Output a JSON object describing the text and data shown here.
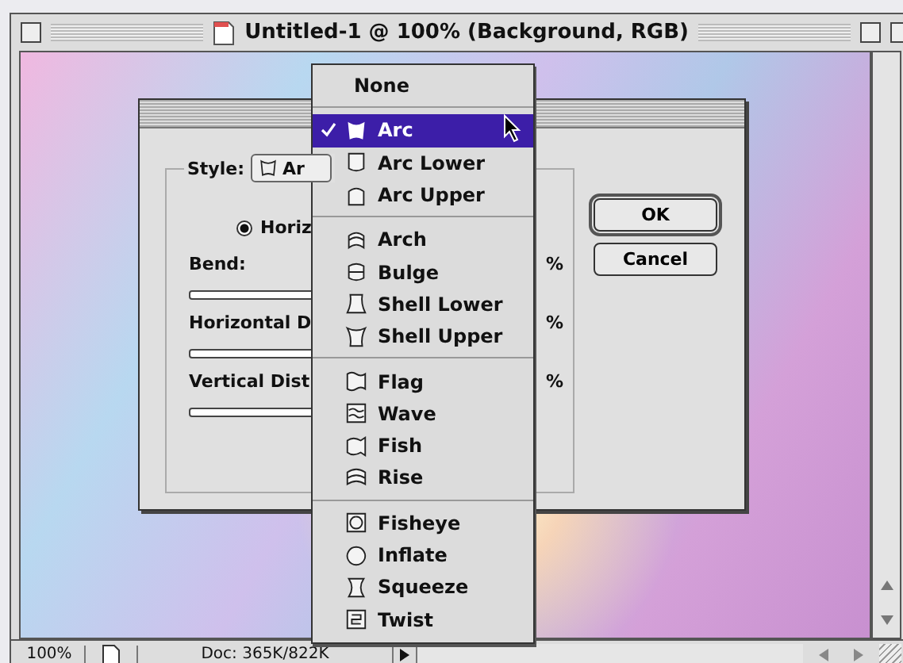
{
  "window": {
    "title": "Untitled-1 @ 100% (Background, RGB)"
  },
  "dialog": {
    "style_label": "Style:",
    "style_value": "Ar",
    "orientation": {
      "label": "Horiz",
      "selected": true
    },
    "sliders": [
      {
        "label": "Bend:",
        "unit": "%"
      },
      {
        "label": "Horizontal D",
        "unit": "%"
      },
      {
        "label": "Vertical Dist",
        "unit": "%"
      }
    ],
    "buttons": [
      {
        "label": "OK",
        "default": true
      },
      {
        "label": "Cancel",
        "default": false
      }
    ]
  },
  "menu": {
    "sections": [
      {
        "items": [
          {
            "label": "None",
            "selected": false,
            "kind": "plain"
          }
        ]
      },
      {
        "items": [
          {
            "label": "Arc",
            "selected": true,
            "kind": "shape"
          },
          {
            "label": "Arc Lower",
            "selected": false,
            "kind": "shape"
          },
          {
            "label": "Arc Upper",
            "selected": false,
            "kind": "shape"
          }
        ]
      },
      {
        "items": [
          {
            "label": "Arch",
            "selected": false,
            "kind": "shape"
          },
          {
            "label": "Bulge",
            "selected": false,
            "kind": "shape"
          },
          {
            "label": "Shell Lower",
            "selected": false,
            "kind": "shape"
          },
          {
            "label": "Shell Upper",
            "selected": false,
            "kind": "shape"
          }
        ]
      },
      {
        "items": [
          {
            "label": "Flag",
            "selected": false,
            "kind": "shape"
          },
          {
            "label": "Wave",
            "selected": false,
            "kind": "shape"
          },
          {
            "label": "Fish",
            "selected": false,
            "kind": "shape"
          },
          {
            "label": "Rise",
            "selected": false,
            "kind": "shape"
          }
        ]
      },
      {
        "items": [
          {
            "label": "Fisheye",
            "selected": false,
            "kind": "shape"
          },
          {
            "label": "Inflate",
            "selected": false,
            "kind": "shape"
          },
          {
            "label": "Squeeze",
            "selected": false,
            "kind": "shape"
          },
          {
            "label": "Twist",
            "selected": false,
            "kind": "shape"
          }
        ]
      }
    ]
  },
  "status_bar": {
    "zoom": "100%",
    "doc": "Doc: 365K/822K"
  }
}
